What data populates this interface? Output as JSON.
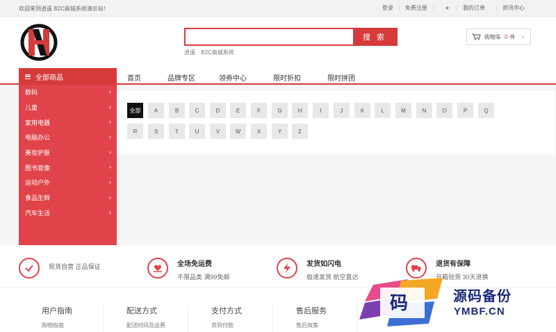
{
  "topbar": {
    "welcome": "欢迎来到逍遥 B2C商城系统演示站！",
    "links": [
      "登录",
      "免费注册",
      "我的订单",
      "资讯中心"
    ]
  },
  "header": {
    "search_value": "",
    "search_button": "搜 索",
    "hotwords": [
      "逍遥",
      "B2C商城系统"
    ],
    "cart_label": "购物车",
    "cart_count": "0",
    "cart_unit": "件"
  },
  "nav": {
    "all_categories": "全部商品",
    "links": [
      "首页",
      "品牌专区",
      "领券中心",
      "限时折扣",
      "限时拼团"
    ]
  },
  "sidebar": {
    "items": [
      "数码",
      "儿童",
      "家用电器",
      "电脑办公",
      "美妆护肤",
      "图书音像",
      "运动户外",
      "食品生鲜",
      "汽车生活"
    ]
  },
  "brand_letters": [
    "全部",
    "A",
    "B",
    "C",
    "D",
    "E",
    "F",
    "G",
    "H",
    "I",
    "J",
    "K",
    "L",
    "M",
    "N",
    "O",
    "P",
    "Q",
    "R",
    "S",
    "T",
    "U",
    "V",
    "W",
    "X",
    "Y",
    "Z"
  ],
  "services": [
    {
      "title": "",
      "sub": "现货自营 正品保证",
      "icon": "check-icon"
    },
    {
      "title": "全场免运费",
      "sub": "不限品类 满99免邮",
      "icon": "heart-hand-icon"
    },
    {
      "title": "发货如闪电",
      "sub": "极速发货 航空直达",
      "icon": "lightning-icon"
    },
    {
      "title": "退货有保障",
      "sub": "开箱验货 30天退换",
      "icon": "truck-icon"
    }
  ],
  "footer": [
    {
      "title": "用户指南",
      "sub": "购物指南"
    },
    {
      "title": "配送方式",
      "sub": "配送时间及运费"
    },
    {
      "title": "支付方式",
      "sub": "货到付款"
    },
    {
      "title": "售后服务",
      "sub": "售后政策"
    }
  ],
  "watermark": {
    "char": "码",
    "text": "源码备份",
    "url": "YMBF.CN"
  },
  "colors": {
    "brand": "#d63a3a",
    "sidebar": "#e0444a"
  }
}
